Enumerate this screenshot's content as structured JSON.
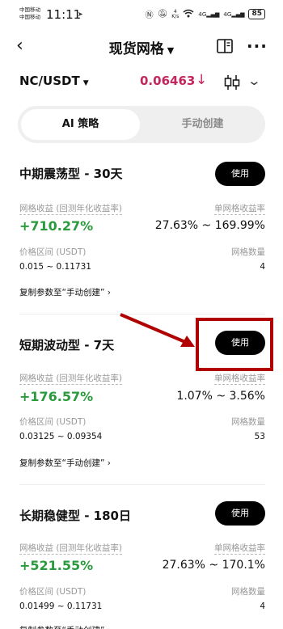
{
  "status_bar": {
    "carrier_line1": "中国移动",
    "carrier_line2": "中国移动",
    "time": "11:11",
    "net_speed_top": "4",
    "net_speed_unit": "K/s",
    "signal1": "4G",
    "signal2": "4G",
    "battery": "85"
  },
  "header": {
    "back_glyph": "‹",
    "title": "现货网格",
    "more_glyph": "···"
  },
  "pair": {
    "symbol": "NC/USDT",
    "price": "0.06463",
    "price_color": "#c2265d"
  },
  "tabs": [
    {
      "label": "AI 策略",
      "active": true
    },
    {
      "label": "手动创建",
      "active": false
    }
  ],
  "labels": {
    "yield_label": "网格收益 (回测年化收益率)",
    "single_yield_label": "单网格收益率",
    "price_range_label": "价格区间 (USDT)",
    "grid_count_label": "网格数量",
    "copy_link": "复制参数至“手动创建”",
    "use_button": "使用"
  },
  "strategies": [
    {
      "name": "中期震荡型 - 30天",
      "yield": "+710.27%",
      "single_yield": "27.63% ~ 169.99%",
      "price_range": "0.015 ~ 0.11731",
      "grid_count": "4"
    },
    {
      "name": "短期波动型 - 7天",
      "yield": "+176.57%",
      "single_yield": "1.07% ~ 3.56%",
      "price_range": "0.03125 ~ 0.09354",
      "grid_count": "53"
    },
    {
      "name": "长期稳健型 - 180日",
      "yield": "+521.55%",
      "single_yield": "27.63% ~ 170.1%",
      "price_range": "0.01499 ~ 0.11731",
      "grid_count": "4"
    }
  ],
  "colors": {
    "positive": "#2a9a3c",
    "annotation": "#b00000"
  }
}
